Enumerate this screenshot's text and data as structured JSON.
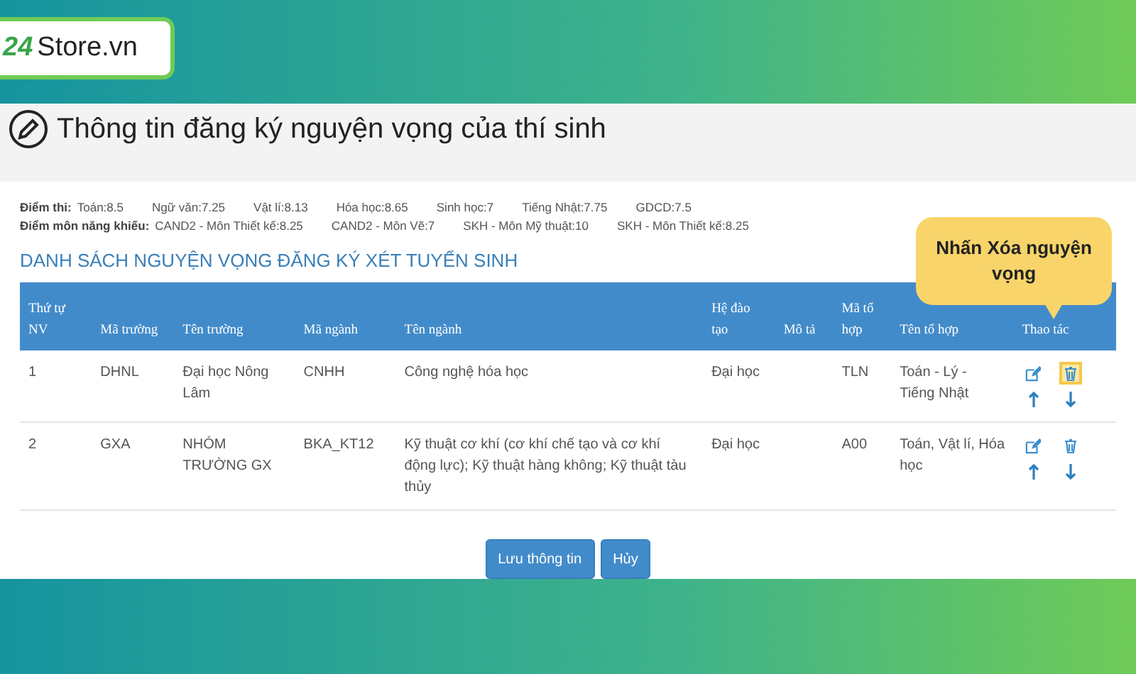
{
  "logo": {
    "number": "24",
    "text": "Store.vn"
  },
  "page_title": "Thông tin đăng ký nguyện vọng của thí sinh",
  "scores": {
    "label": "Điểm thi:",
    "items": [
      "Toán:8.5",
      "Ngữ văn:7.25",
      "Vật lí:8.13",
      "Hóa học:8.65",
      "Sinh học:7",
      "Tiếng Nhật:7.75",
      "GDCD:7.5"
    ]
  },
  "aptitude_scores": {
    "label": "Điểm môn năng khiếu:",
    "items": [
      "CAND2 - Môn Thiết kế:8.25",
      "CAND2 - Môn Vẽ:7",
      "SKH - Môn Mỹ thuật:10",
      "SKH - Môn Thiết kế:8.25"
    ]
  },
  "section_title": "DANH SÁCH NGUYỆN VỌNG ĐĂNG KÝ XÉT TUYỂN SINH",
  "table": {
    "columns": [
      "Thứ tự NV",
      "Mã trường",
      "Tên trường",
      "Mã ngành",
      "Tên ngành",
      "Hệ đào tạo",
      "Mô tả",
      "Mã tổ hợp",
      "Tên tổ hợp",
      "Thao tác"
    ],
    "rows": [
      {
        "cells": [
          "1",
          "DHNL",
          "Đại học Nông Lâm",
          "CNHH",
          "Công nghệ hóa học",
          "Đại học",
          "",
          "TLN",
          "Toán - Lý - Tiếng Nhật"
        ],
        "delete_highlighted": true
      },
      {
        "cells": [
          "2",
          "GXA",
          "NHÓM TRƯỜNG GX",
          "BKA_KT12",
          "Kỹ thuật cơ khí (cơ khí chế tạo và cơ khí động lực); Kỹ thuật hàng không; Kỹ thuật tàu thủy",
          "Đại học",
          "",
          "A00",
          "Toán, Vật lí, Hóa học"
        ],
        "delete_highlighted": false
      }
    ]
  },
  "buttons": [
    "Lưu thông tin",
    "Hủy"
  ],
  "callout": "Nhấn Xóa nguyện vọng"
}
